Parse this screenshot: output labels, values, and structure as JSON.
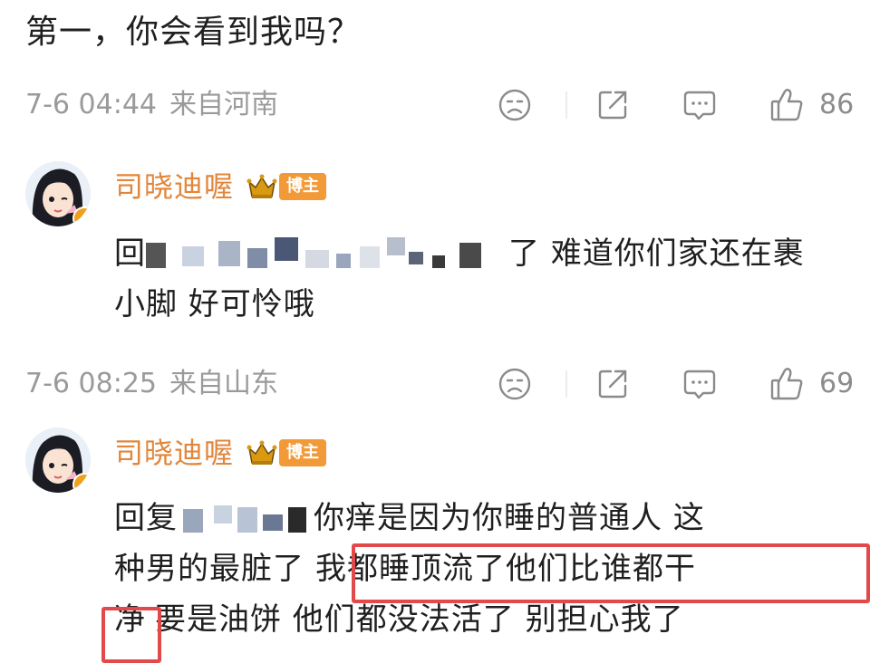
{
  "top_text": "第一，你会看到我吗？",
  "meta": [
    {
      "date": "7-6 04:44",
      "location": "来自河南",
      "likes": "86"
    },
    {
      "date": "7-6 08:25",
      "location": "来自山东",
      "likes": "69"
    }
  ],
  "replies": [
    {
      "username": "司晓迪喔",
      "badge": "博主",
      "reply_prefix": "回",
      "line1_tail": "了 难道你们家还在裹",
      "line2": "小脚 好可怜哦"
    },
    {
      "username": "司晓迪喔",
      "badge": "博主",
      "reply_prefix": "回复",
      "line1_tail": "你痒是因为你睡的普通人 这",
      "line2_a": "种男的最脏了",
      "line2_b": "我都睡顶流了他们比谁都干",
      "line3_a": "净",
      "line3_b": "要是油饼 他们都没法活了 别担心我了"
    }
  ],
  "icons": {
    "dislike": "sad-face-icon",
    "share": "share-icon",
    "comment": "comment-icon",
    "like": "thumbs-up-icon",
    "crown": "crown-icon",
    "avatar": "avatar"
  },
  "colors": {
    "username": "#e2863b",
    "badge": "#f29a38",
    "meta": "#9a9a9a",
    "highlight": "#e24a4a"
  }
}
